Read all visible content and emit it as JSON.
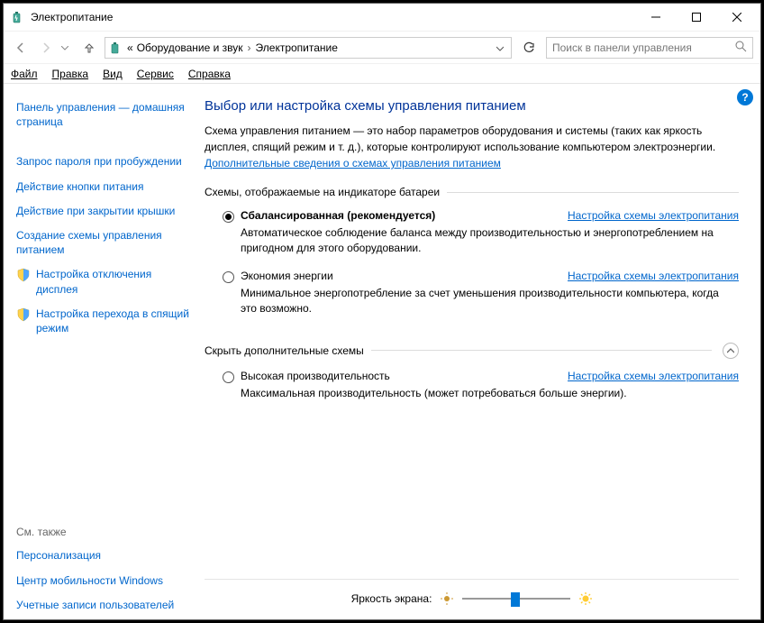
{
  "window": {
    "title": "Электропитание"
  },
  "menubar": {
    "file": "Файл",
    "edit": "Правка",
    "view": "Вид",
    "service": "Сервис",
    "help": "Справка"
  },
  "breadcrumb": {
    "prefix": "«",
    "level1": "Оборудование и звук",
    "level2": "Электропитание"
  },
  "search": {
    "placeholder": "Поиск в панели управления"
  },
  "sidebar": {
    "home": "Панель управления — домашняя страница",
    "password": "Запрос пароля при пробуждении",
    "power_button": "Действие кнопки питания",
    "lid": "Действие при закрытии крышки",
    "create_plan": "Создание схемы управления питанием",
    "display_off": "Настройка отключения дисплея",
    "sleep": "Настройка перехода в спящий режим",
    "see_also": "См. также",
    "personalization": "Персонализация",
    "mobility": "Центр мобильности Windows",
    "accounts": "Учетные записи пользователей"
  },
  "main": {
    "title": "Выбор или настройка схемы управления питанием",
    "intro_text": "Схема управления питанием — это набор параметров оборудования и системы (таких как яркость дисплея, спящий режим и т. д.), которые контролируют использование компьютером электроэнергии. ",
    "intro_link": "Дополнительные сведения о схемах управления питанием",
    "group1_title": "Схемы, отображаемые на индикаторе батареи",
    "group2_title": "Скрыть дополнительные схемы",
    "change_link": "Настройка схемы электропитания",
    "plans": {
      "balanced": {
        "name": "Сбалансированная (рекомендуется)",
        "desc": "Автоматическое соблюдение баланса между производительностью и энергопотреблением на пригодном для этого оборудовании."
      },
      "saver": {
        "name": "Экономия энергии",
        "desc": "Минимальное энергопотребление за счет уменьшения производительности компьютера, когда это возможно."
      },
      "high": {
        "name": "Высокая производительность",
        "desc": "Максимальная производительность (может потребоваться больше энергии)."
      }
    },
    "brightness_label": "Яркость экрана:"
  }
}
